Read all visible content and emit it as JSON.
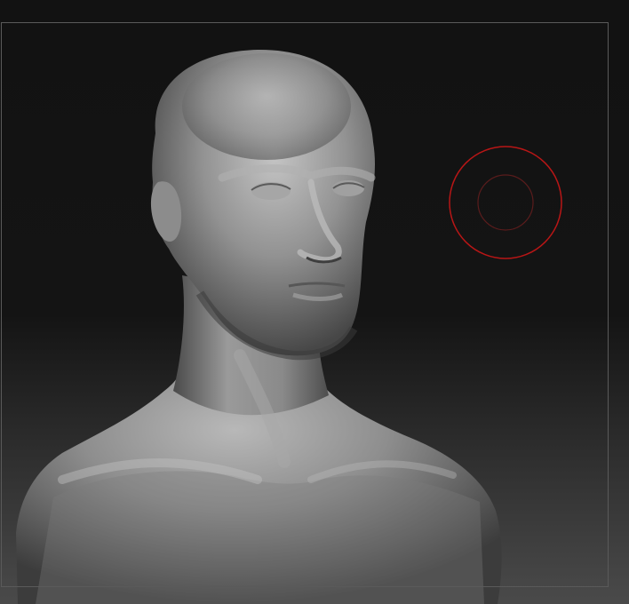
{
  "viewport": {
    "background_top": "#121212",
    "background_mid": "#141414",
    "background_bottom": "#4a4a4a",
    "frame_color": "#5a5a5a"
  },
  "model": {
    "name": "sculpt-bust",
    "material": "matte-gray-clay",
    "base_color": "#8e8e8e",
    "highlight_color": "#c4c4c4",
    "shadow_color": "#3c3c3c"
  },
  "brush": {
    "icon": "brush-cursor-icon",
    "outer_color": "#b81616",
    "inner_color": "#5a1c1c"
  }
}
